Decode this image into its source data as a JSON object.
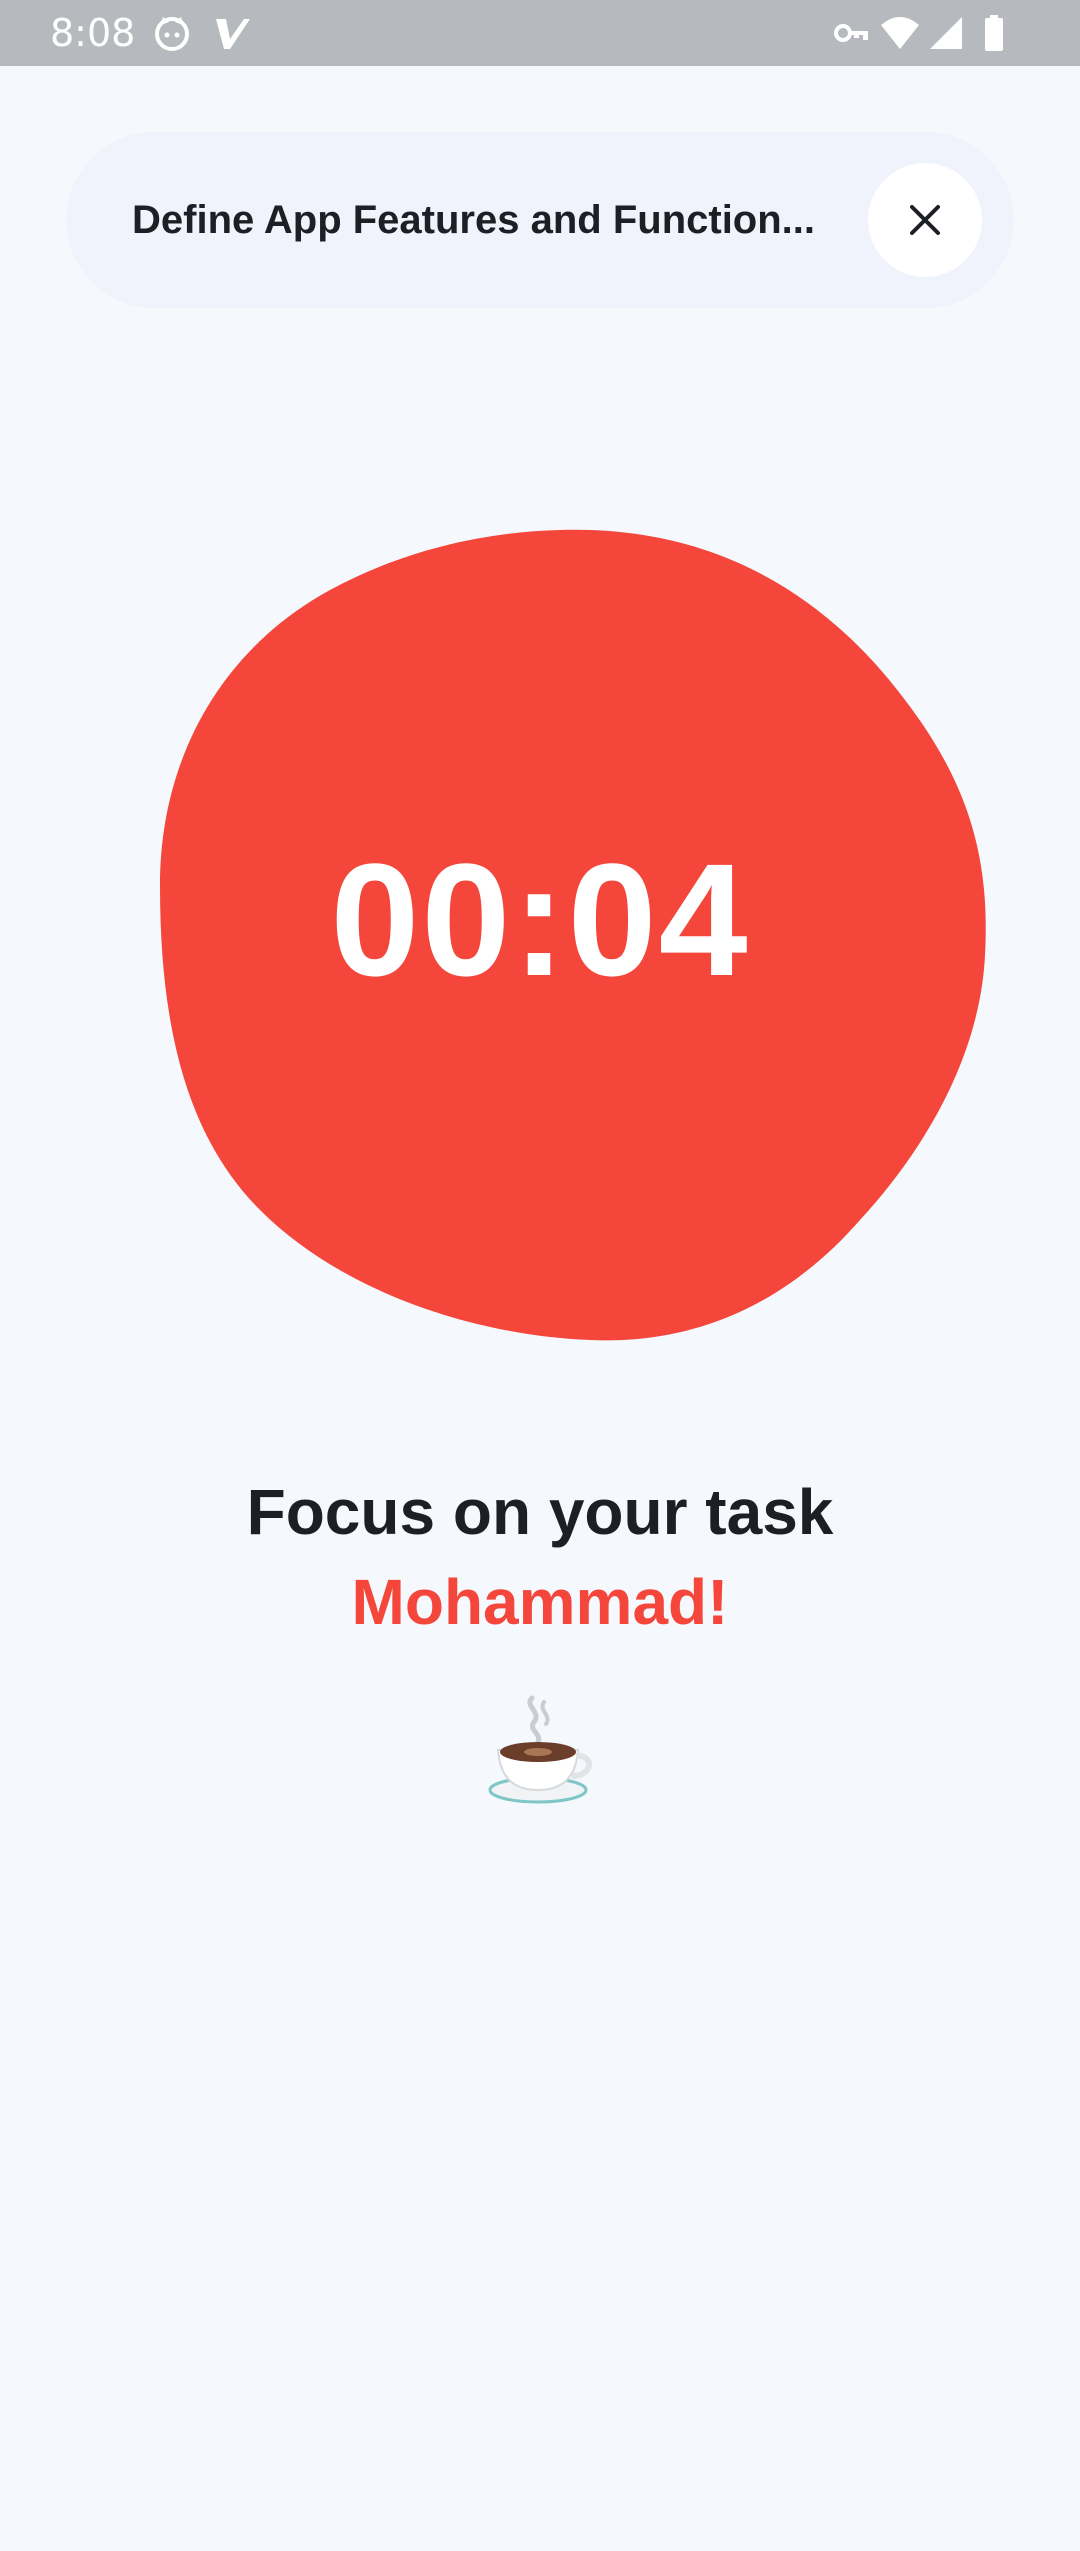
{
  "status_bar": {
    "time": "8:08",
    "icons": [
      "cat-face-icon",
      "v-app-icon",
      "vpn-key-icon",
      "wifi-icon",
      "signal-icon",
      "battery-icon"
    ]
  },
  "task": {
    "title": "Define App Features and Function..."
  },
  "timer": {
    "value": "00:04"
  },
  "message": {
    "line1": "Focus on your task",
    "line2": "Mohammad!"
  },
  "colors": {
    "accent": "#f4463b",
    "background": "#f5f8fc",
    "pill": "#f0f2fc",
    "text": "#1c1f24"
  }
}
